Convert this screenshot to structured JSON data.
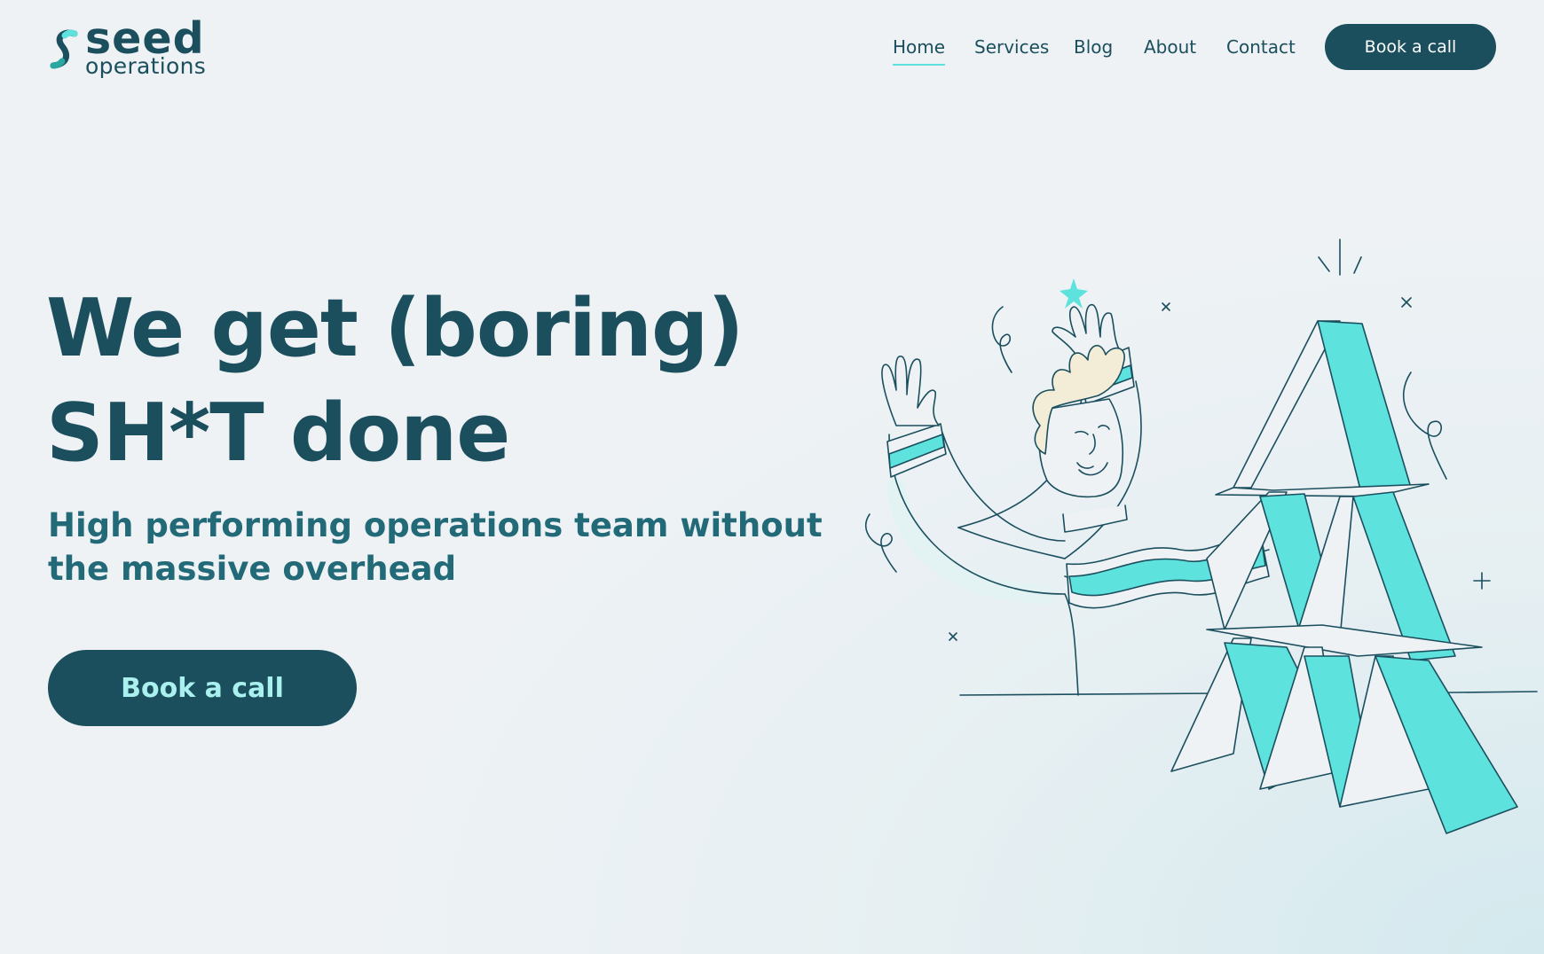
{
  "brand": {
    "name": "seed",
    "tagline": "operations",
    "logo_icon": "seed-s-logo-icon",
    "colors": {
      "primary": "#1b4f5e",
      "accent": "#5ee2de",
      "text_light": "#aaf0ee",
      "background": "#eff2f5"
    }
  },
  "nav": {
    "items": [
      {
        "label": "Home",
        "active": true
      },
      {
        "label": "Services",
        "active": false
      },
      {
        "label": "Blog",
        "active": false
      },
      {
        "label": "About",
        "active": false
      },
      {
        "label": "Contact",
        "active": false
      }
    ],
    "cta_label": "Book a call"
  },
  "hero": {
    "title_line1": "We get (boring)",
    "title_line2": "SH*T done",
    "subtitle_line1": "High performing operations team without",
    "subtitle_line2": "the massive overhead",
    "cta_label": "Book a call"
  },
  "illustration": {
    "icon": "person-with-house-of-cards-illustration"
  }
}
